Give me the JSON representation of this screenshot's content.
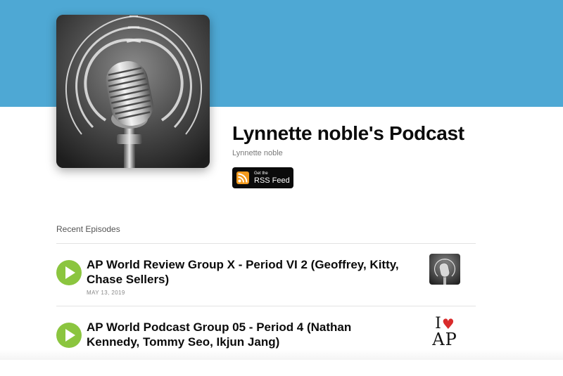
{
  "header": {
    "background_color": "#4ea8d4",
    "cover_icon": "microphone-icon"
  },
  "podcast": {
    "title": "Lynnette noble's Podcast",
    "author": "Lynnette noble"
  },
  "rss_button": {
    "small_label": "Get the",
    "label": "RSS Feed",
    "icon": "rss-icon"
  },
  "episodes_section": {
    "title": "Recent Episodes",
    "items": [
      {
        "title": "AP World Review Group X - Period VI 2 (Geoffrey, Kitty, Chase Sellers)",
        "date": "MAY 13, 2019",
        "thumbnail": "microphone-icon"
      },
      {
        "title": "AP World Podcast Group 05 - Period 4 (Nathan Kennedy, Tommy Seo, Ikjun Jang)",
        "date": "",
        "thumbnail_text_top": "I",
        "thumbnail_text_bottom": "AP",
        "thumbnail_heart": "♥"
      }
    ]
  },
  "colors": {
    "play_button": "#8bc53f",
    "heart": "#d92b2b"
  }
}
